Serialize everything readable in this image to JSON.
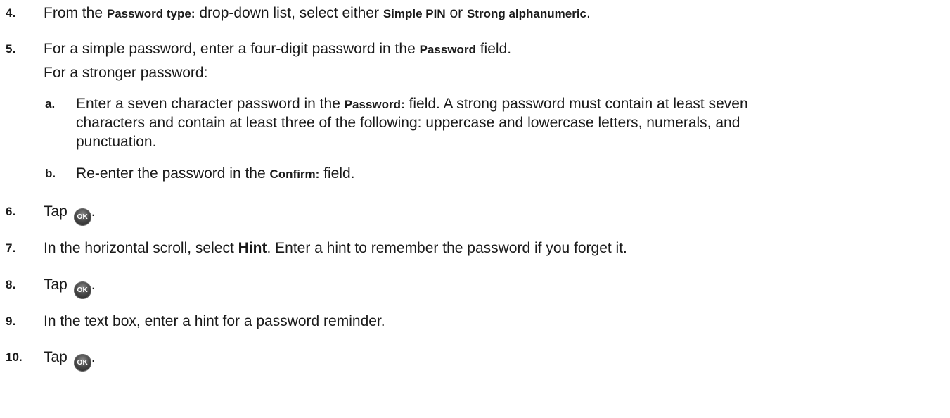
{
  "steps": {
    "s4": {
      "num": "4.",
      "t1": "From the ",
      "b1": "Password type:",
      "t2": " drop-down list, select either ",
      "b2": "Simple PIN",
      "t3": " or ",
      "b3": "Strong alphanumeric",
      "t4": "."
    },
    "s5": {
      "num": "5.",
      "t1": "For a simple password, enter a four-digit password in the ",
      "b1": "Password",
      "t2": " field.",
      "line2": "For a stronger password:"
    },
    "s5a": {
      "label": "a.",
      "t1": "Enter a seven character password in the ",
      "b1": "Password:",
      "t2": " field. A strong password must contain at least seven",
      "line2": "characters and contain at least three of the following: uppercase and lowercase letters, numerals, and",
      "line3": "punctuation."
    },
    "s5b": {
      "label": "b.",
      "t1": "Re-enter the password in the ",
      "b1": "Confirm:",
      "t2": " field."
    },
    "s6": {
      "num": "6.",
      "t1": "Tap ",
      "t2": "."
    },
    "s7": {
      "num": "7.",
      "t1": "In the horizontal scroll, select ",
      "b1": "Hint",
      "t2": ". Enter a hint to remember the password if you forget it."
    },
    "s8": {
      "num": "8.",
      "t1": "Tap ",
      "t2": "."
    },
    "s9": {
      "num": "9.",
      "t1": "In the text box, enter a hint for a password reminder."
    },
    "s10": {
      "num": "10.",
      "t1": "Tap ",
      "t2": "."
    }
  },
  "ok_icon": {
    "label": "OK",
    "icon": "ok-button-icon"
  }
}
